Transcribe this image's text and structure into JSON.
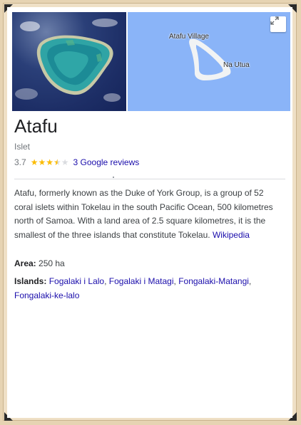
{
  "place": {
    "name": "Atafu",
    "type": "Islet",
    "rating": "3.7",
    "rating_value": 3.7,
    "rating_max": 5,
    "reviews_link": "3 Google reviews"
  },
  "map": {
    "labels": [
      "Atafu Village",
      "Na Utua"
    ],
    "water_color": "#8ab4f8",
    "land_color": "#f1f3f4",
    "expand_icon": "expand-diagonal-icon"
  },
  "description": {
    "text": "Atafu, formerly known as the Duke of York Group, is a group of 52 coral islets within Tokelau in the south Pacific Ocean, 500 kilometres north of Samoa. With a land area of 2.5 square kilometres, it is the smallest of the three islands that constitute Tokelau.",
    "source_link": "Wikipedia"
  },
  "facts": {
    "area": {
      "label": "Area:",
      "value": "250 ha"
    },
    "islands": {
      "label": "Islands:",
      "items": [
        "Fogalaki i Lalo",
        "Fogalaki i Matagi",
        "Fongalaki-Matangi",
        "Fongalaki-ke-lalo"
      ],
      "separator": ","
    }
  },
  "colors": {
    "link": "#1a0dab",
    "star": "#fbbc04",
    "frame": "#efe0c6"
  }
}
